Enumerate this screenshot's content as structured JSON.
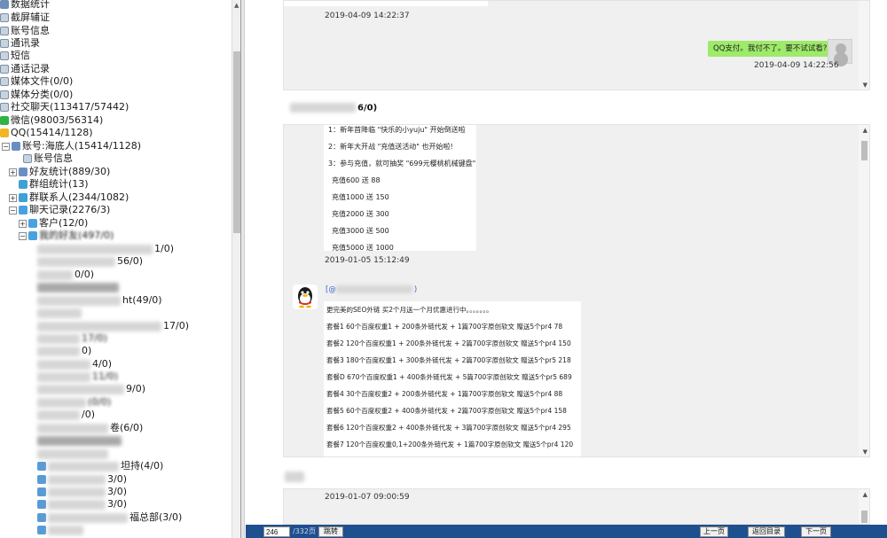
{
  "tree": {
    "items": [
      {
        "label": "数据统计",
        "indent": 0
      },
      {
        "label": "截屏辅证",
        "indent": 0
      },
      {
        "label": "账号信息",
        "indent": 0
      },
      {
        "label": "通讯录",
        "indent": 0
      },
      {
        "label": "短信",
        "indent": 0
      },
      {
        "label": "通话记录",
        "indent": 0
      },
      {
        "label": "媒体文件(0/0)",
        "indent": 0
      },
      {
        "label": "媒体分类(0/0)",
        "indent": 0
      },
      {
        "label": "社交聊天(113417/57442)",
        "indent": 0
      },
      {
        "label": "微信(98003/56314)",
        "indent": 0
      },
      {
        "label": "QQ(15414/1128)",
        "indent": 0
      },
      {
        "label": "账号:海底人(15414/1128)",
        "indent": 1
      },
      {
        "label": "账号信息",
        "indent": 2
      },
      {
        "label": "好友统计(889/30)",
        "indent": 2
      },
      {
        "label": "群组统计(13)",
        "indent": 2
      },
      {
        "label": "群联系人(2344/1082)",
        "indent": 2
      },
      {
        "label": "聊天记录(2276/3)",
        "indent": 2
      },
      {
        "label": "客户(12/0)",
        "indent": 3
      },
      {
        "label": "我的好友(497/0)",
        "indent": 3
      }
    ],
    "blurred_tails": [
      "1/0)",
      "56/0)",
      "0/0)",
      "ht(49/0)",
      "17/0)",
      "17/0)",
      "0)",
      "4/0)",
      "11/0)",
      "9/0)",
      "(0/0)",
      "/0)",
      "卷(6/0)",
      "坦持(4/0)",
      "3/0)",
      "3/0)",
      "3/0)",
      "福总部(3/0)"
    ]
  },
  "chat": {
    "top_timestamp": "2019-04-09 14:22:37",
    "outgoing_message": "QQ支付。我付不了。要不试试看?",
    "outgoing_timestamp": "2019-04-09 14:22:56",
    "section_header_suffix": "6/0)",
    "promo_lines": [
      "1：新年首降临 \"快乐的小yuju\" 开始倒送啦",
      "2：新年大开战 \"充值送活动\" 也开始啦!",
      "3：参与充值，就可抽奖 \"699元樱桃机械键盘\"",
      "充值600  送  88",
      "充值1000  送  150",
      "充值2000  送  300",
      "充值3000  送  500",
      "充值5000  送  1000"
    ],
    "promo_timestamp": "2019-01-05 15:12:49",
    "sender_prefix": "[@",
    "sender_suffix": ")",
    "seo_lines": [
      "更完美的SEO外链 买2个月送一个月优惠进行中。。。。。。。",
      "套餐1  60个百度权重1  + 200条外链代发 + 1篇700字原创软文 赠送5个pr4 78",
      "套餐2  120个百度权重1 + 200条外链代发 + 2篇700字原创软文 赠送5个pr4 150",
      "套餐3  180个百度权重1 + 300条外链代发 + 2篇700字原创软文 赠送5个pr5 218",
      "套餐D  670个百度权重1 + 400条外链代发 + 5篇700字原创软文 赠送5个pr5 689",
      "套餐4  30个百度权重2 + 200条外链代发 + 1篇700字原创软文 赠送5个pr4 88",
      "套餐5  60个百度权重2 + 400条外链代发 + 2篇700字原创软文 赠送5个pr4 158",
      "套餐6  120个百度权重2 + 400条外链代发 + 3篇700字原创软文 赠送5个pr4 295",
      "套餐7  120个百度权重0,1+200条外链代发 + 1篇700字原创软文 赠送5个pr4 120"
    ],
    "bottom_timestamp": "2019-01-07 09:00:59"
  },
  "toolbar": {
    "page_value": "246",
    "page_total": "/332页",
    "jump_label": "跳转",
    "prev_label": "上一页",
    "back_label": "返回目录",
    "next_label": "下一页"
  },
  "colors": {
    "toolbar_bg": "#1e4f8f",
    "chat_frame_bg": "#f0f0f0",
    "outgoing_bubble": "#9eea6a",
    "sender_link": "#3366cc"
  }
}
